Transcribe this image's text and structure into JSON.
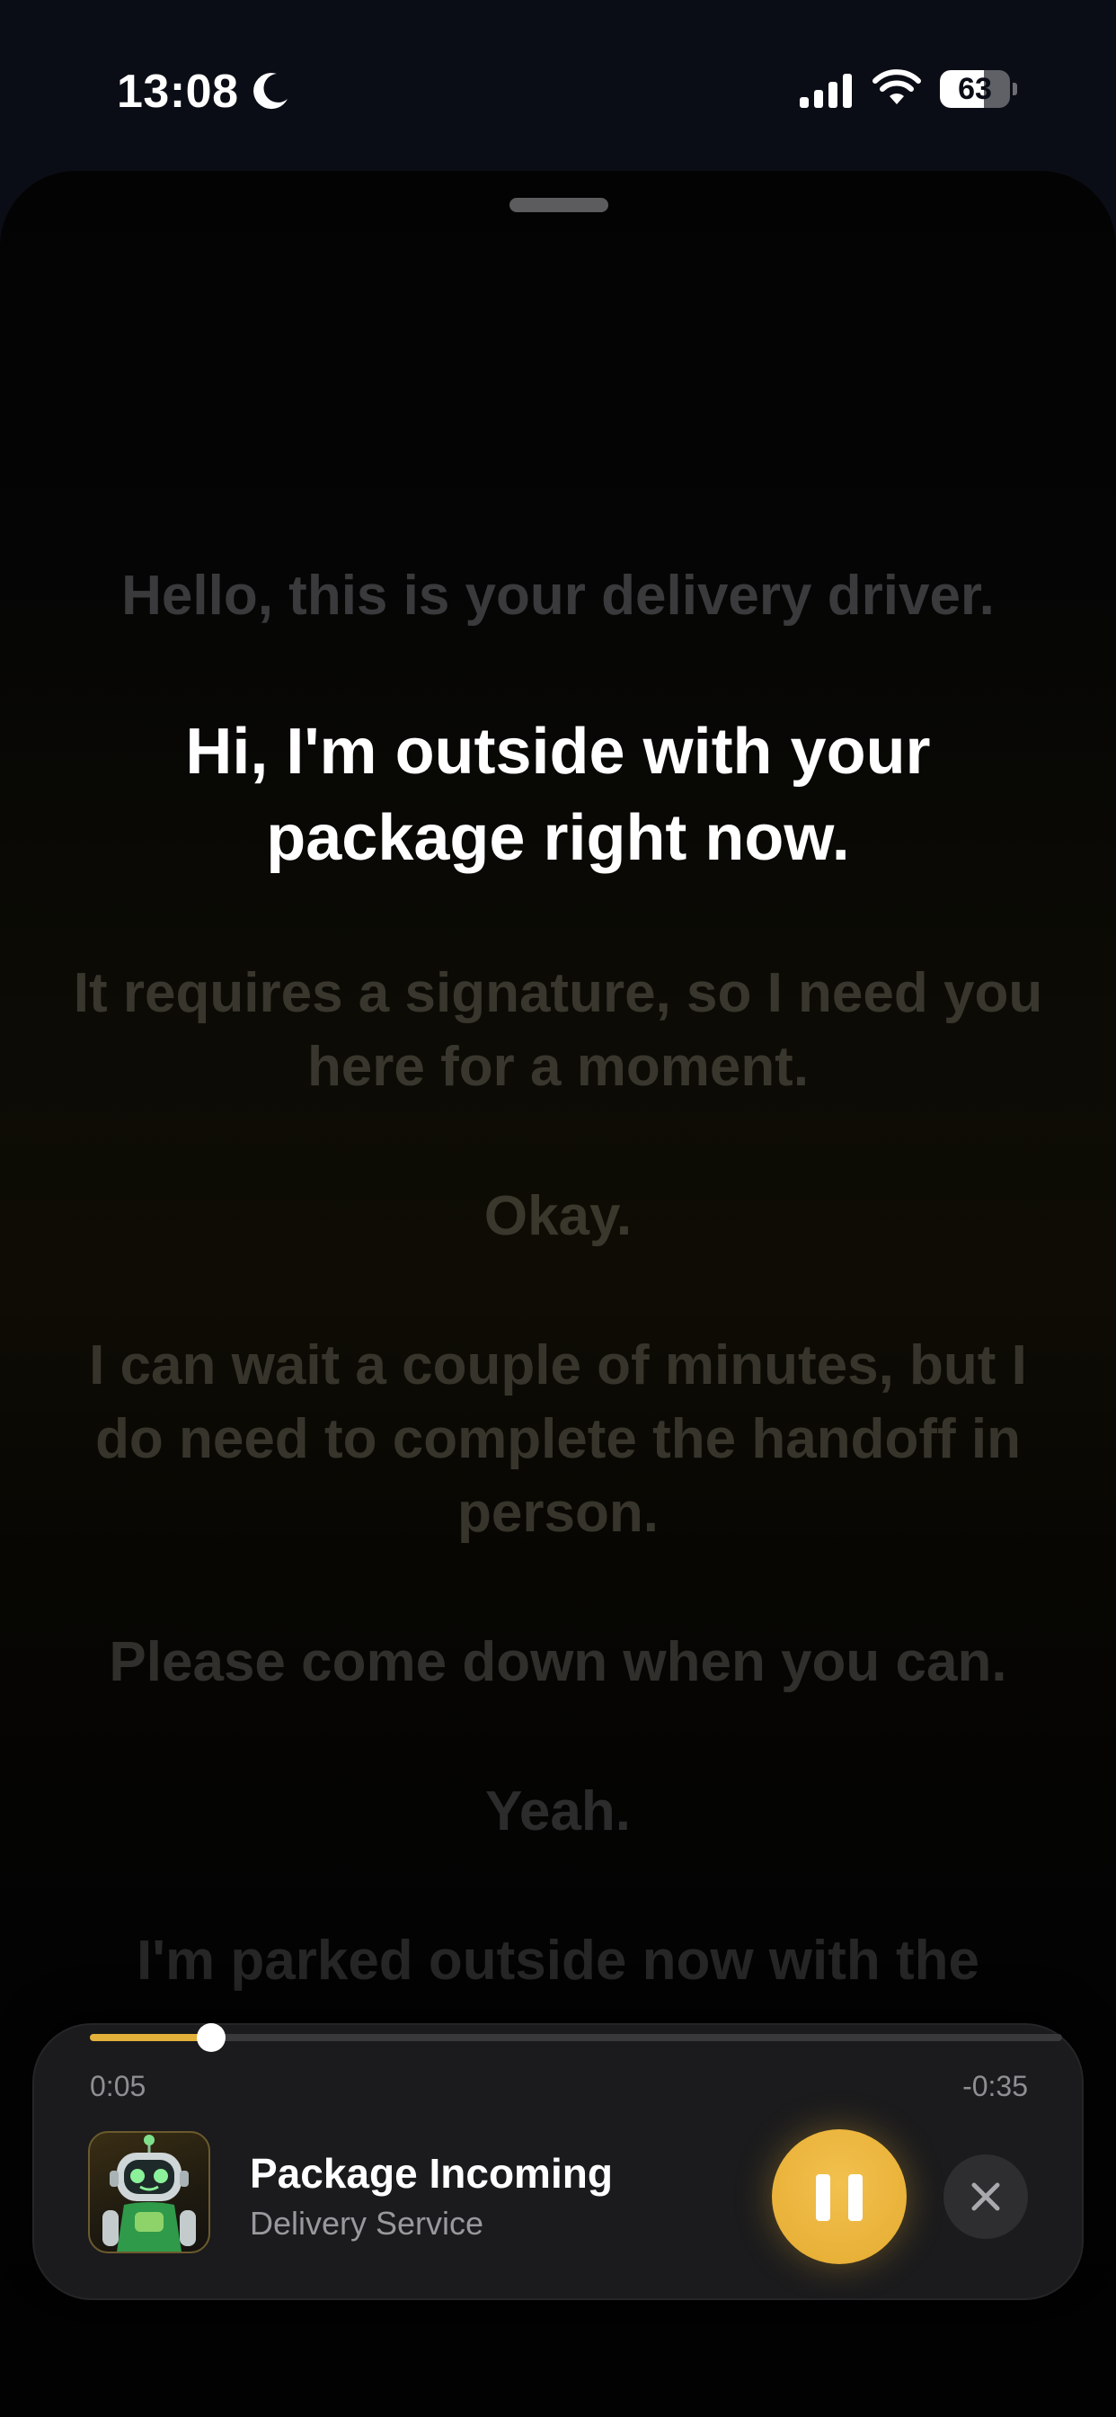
{
  "status_bar": {
    "time": "13:08",
    "battery_level": "63",
    "icons": [
      "moon-icon",
      "signal-icon",
      "wifi-icon",
      "battery-icon"
    ]
  },
  "lyrics": {
    "lines": [
      "Hello, this is your delivery driver.",
      "Hi, I'm outside with your package right now.",
      "It requires a signature, so I need you here for a moment.",
      "Okay.",
      "I can wait a couple of minutes, but I do need to complete the handoff in person.",
      "Please come down when you can.",
      "Yeah.",
      "I'm parked outside now with the"
    ],
    "active_index": 1
  },
  "player": {
    "elapsed": "0:05",
    "remaining": "-0:35",
    "progress": 0.125,
    "title": "Package Incoming",
    "subtitle": "Delivery Service",
    "artwork_icon": "robot-icon",
    "pause_icon": "pause-icon",
    "close_icon": "close-icon"
  },
  "colors": {
    "accent": "#e3b03a",
    "background": "#0b0d16",
    "card": "#1b1b1d",
    "active_text": "#ffffff",
    "dim_text": "#3a3a3c"
  }
}
